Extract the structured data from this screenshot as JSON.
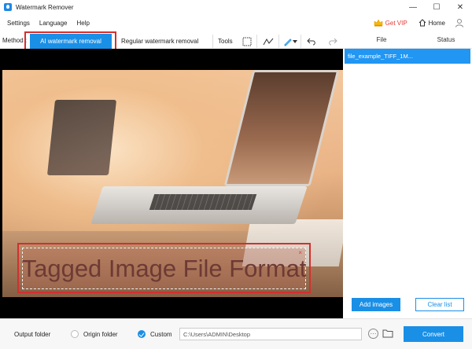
{
  "window": {
    "title": "Watermark Remover",
    "minimize": "—",
    "maximize": "☐",
    "close": "✕"
  },
  "menu": {
    "items": [
      "Settings",
      "Language",
      "Help"
    ],
    "vip": "Get VIP",
    "home": "Home"
  },
  "toolbar": {
    "method_label": "Method :",
    "ai_button": "AI watermark removal",
    "regular_button": "Regular watermark removal",
    "tools_label": "Tools"
  },
  "panel": {
    "file_col": "File",
    "status_col": "Status"
  },
  "files": [
    {
      "name": "file_example_TIFF_1M..."
    }
  ],
  "watermark": {
    "text": "Tagged Image File Format",
    "close": "×"
  },
  "actions": {
    "add_images": "Add images",
    "clear_list": "Clear list"
  },
  "output": {
    "label": "Output folder",
    "origin_label": "Origin folder",
    "custom_label": "Custom",
    "path": "C:\\Users\\ADMIN\\Desktop",
    "more": "···",
    "convert": "Convert"
  },
  "colors": {
    "accent": "#1a8fe6",
    "highlight": "#d32f2f",
    "vip": "#e53935"
  }
}
